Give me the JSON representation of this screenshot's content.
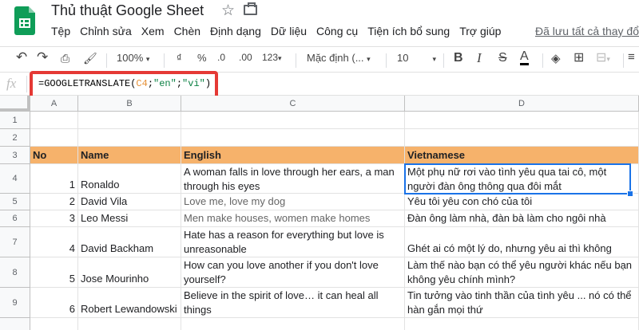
{
  "doc": {
    "title": "Thủ thuật Google Sheet"
  },
  "menu": [
    {
      "label": "Tệp"
    },
    {
      "label": "Chỉnh sửa"
    },
    {
      "label": "Xem"
    },
    {
      "label": "Chèn"
    },
    {
      "label": "Định dạng"
    },
    {
      "label": "Dữ liệu"
    },
    {
      "label": "Công cụ"
    },
    {
      "label": "Tiện ích bổ sung"
    },
    {
      "label": "Trợ giúp"
    }
  ],
  "saved_status": "Đã lưu tất cả thay đổi",
  "toolbar": {
    "zoom": "100%",
    "currency": "₫",
    "percent": "%",
    "dec_decrease": ".0",
    "dec_increase": ".00",
    "more_formats": "123",
    "font": "Mặc định (...",
    "font_size": "10",
    "bold": "B",
    "italic": "I",
    "strike": "S",
    "text_color": "A"
  },
  "formula": {
    "prefix": "=GOOGLETRANSLATE(",
    "ref": "C4",
    "sep1": ";",
    "arg1": "\"en\"",
    "sep2": ";",
    "arg2": "\"vi\"",
    "suffix": ")"
  },
  "columns": [
    "A",
    "B",
    "C",
    "D"
  ],
  "rows": [
    "1",
    "2",
    "3",
    "4",
    "5",
    "6",
    "7",
    "8",
    "9"
  ],
  "table": {
    "headers": {
      "no": "No",
      "name": "Name",
      "english": "English",
      "vietnamese": "Vietnamese"
    },
    "rows": [
      {
        "no": "1",
        "name": "Ronaldo",
        "en": "A woman falls in love through her ears, a man through his eyes",
        "vi": "Một phụ nữ rơi vào tình yêu qua tai cô, một người đàn ông thông qua đôi mắt"
      },
      {
        "no": "2",
        "name": "David Vila",
        "en": "Love me, love my dog",
        "vi": "Yêu tôi yêu con chó của tôi"
      },
      {
        "no": "3",
        "name": "Leo Messi",
        "en": "Men make houses, women make homes",
        "vi": "Đàn ông làm nhà, đàn bà làm cho ngôi nhà"
      },
      {
        "no": "4",
        "name": "David Backham",
        "en": "Hate has a reason for everything but love is unreasonable",
        "vi": "Ghét ai có một lý do, nhưng yêu ai thì không"
      },
      {
        "no": "5",
        "name": "Jose Mourinho",
        "en": "How can you love another if you don't love yourself?",
        "vi": "Làm thế nào bạn có thể yêu người khác nếu bạn không yêu chính mình?"
      },
      {
        "no": "6",
        "name": "Robert Lewandowski",
        "en": "Believe in the spirit of love… it can heal all things",
        "vi": "Tin tưởng vào tinh thần của tình yêu ... nó có thể hàn gắn mọi thứ"
      }
    ]
  }
}
